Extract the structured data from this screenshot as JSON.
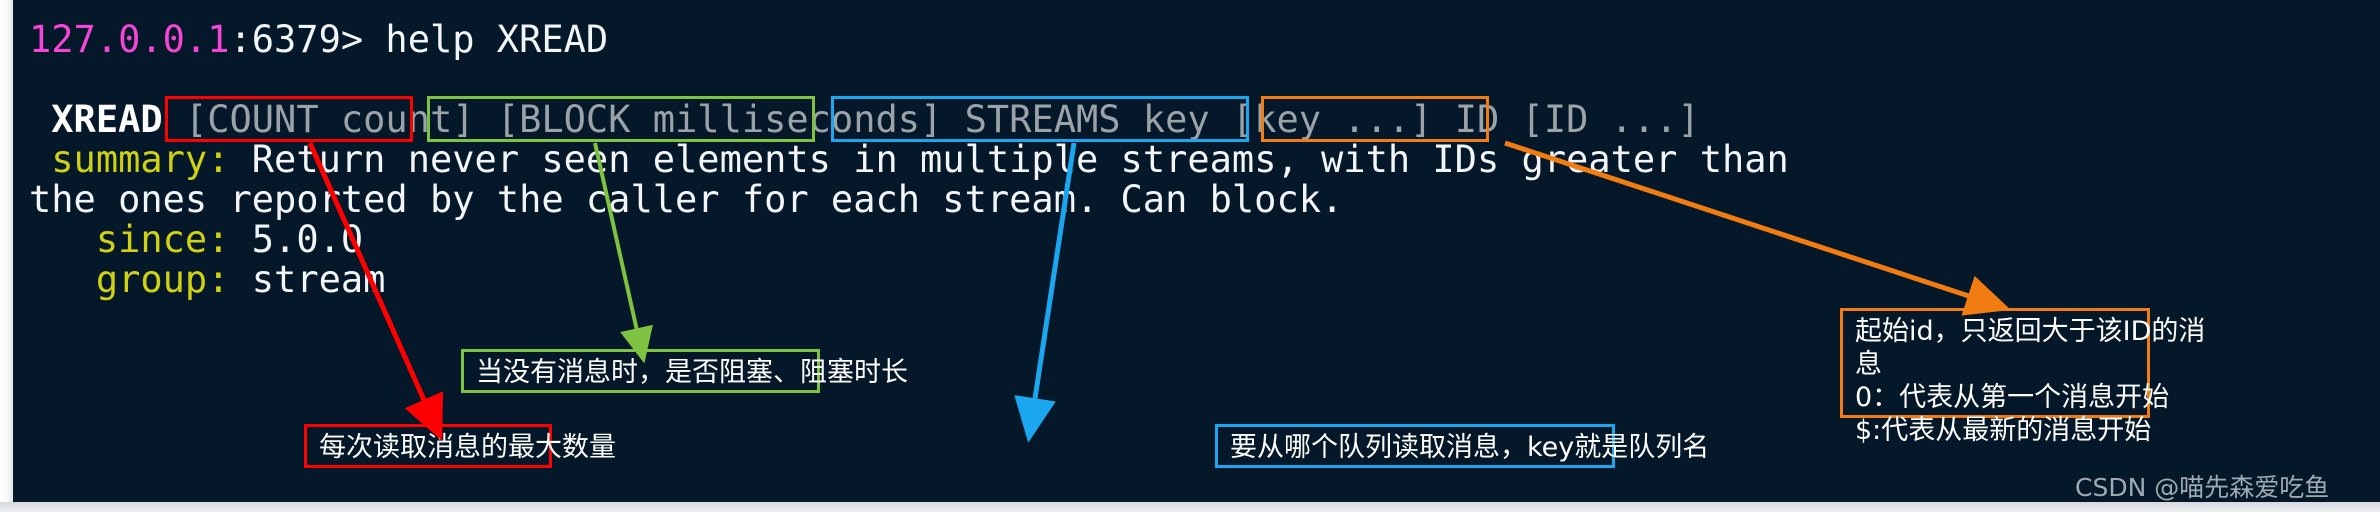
{
  "terminal": {
    "background_color": "#04182a",
    "prompt": {
      "host": "127.0.0.1",
      "host_color": "#f545d6",
      "port_and_caret": ":6379>",
      "command": " help XREAD"
    },
    "usage": {
      "command_name": "XREAD",
      "arg_count": "[COUNT count]",
      "arg_block": "[BLOCK milliseconds]",
      "arg_streams": "STREAMS key [key ...]",
      "arg_id": "ID [ID ...]"
    },
    "fields": [
      {
        "label": "summary:",
        "value_line1": "Return never seen elements in multiple streams, with IDs greater than",
        "value_line2": "the ones reported by the caller for each stream. Can block."
      },
      {
        "label": "since:",
        "value": "5.0.0"
      },
      {
        "label": "group:",
        "value": "stream"
      }
    ],
    "label_color": "#cfd111",
    "value_color": "#f2f6f8",
    "arg_color": "#9aa3a8"
  },
  "annotations": [
    {
      "id": "count-note",
      "color": "#fe0000",
      "color_name": "red",
      "target": "[COUNT count]",
      "lines": [
        "每次读取消息的最大数量"
      ]
    },
    {
      "id": "block-note",
      "color": "#7ec242",
      "color_name": "green",
      "target": "[BLOCK milliseconds]",
      "lines": [
        "当没有消息时，是否阻塞、阻塞时长"
      ]
    },
    {
      "id": "streams-note",
      "color": "#1ba7ef",
      "color_name": "blue",
      "target": "STREAMS key [key ...]",
      "lines": [
        "要从哪个队列读取消息，key就是队列名"
      ]
    },
    {
      "id": "id-note",
      "color": "#f07c12",
      "color_name": "orange",
      "target": "ID [ID ...]",
      "lines": [
        "起始id，只返回大于该ID的消",
        "息",
        "0：代表从第一个消息开始",
        "$:代表从最新的消息开始"
      ]
    }
  ],
  "watermark": {
    "text": "CSDN @喵先森爱吃鱼"
  }
}
